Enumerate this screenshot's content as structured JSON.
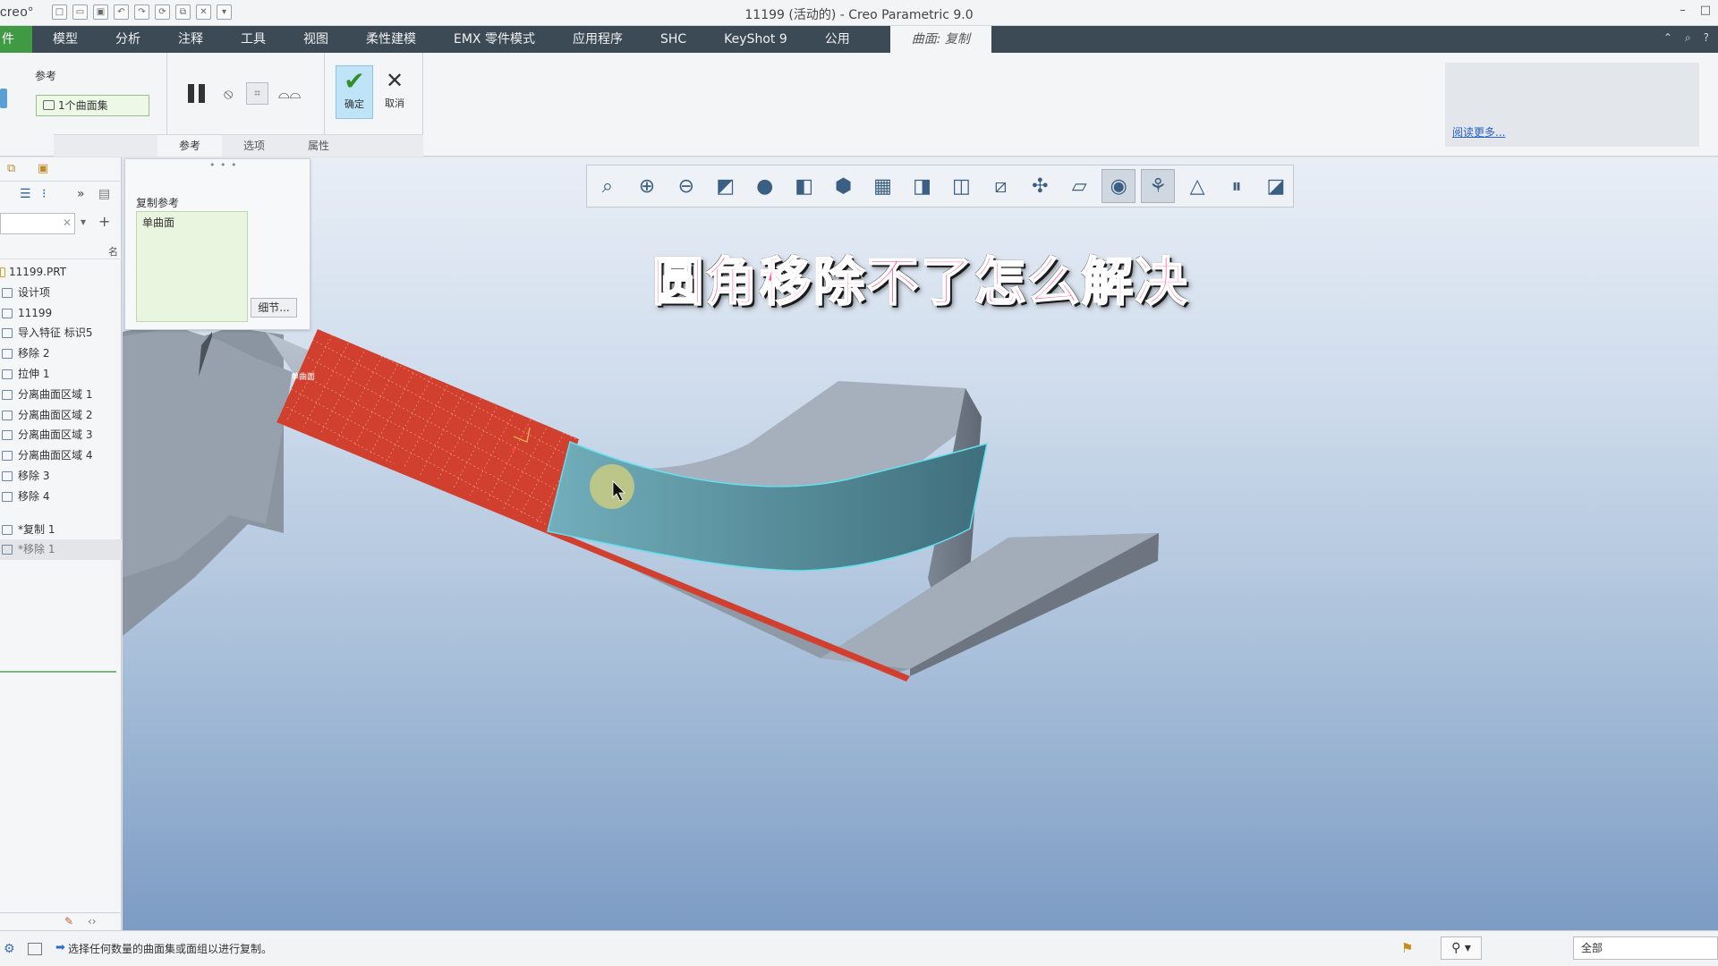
{
  "titlebar": {
    "logo": "creo°",
    "title": "11199 (活动的) - Creo Parametric 9.0",
    "quick_access_icons": [
      "new-icon",
      "open-icon",
      "save-icon",
      "undo-icon",
      "redo-icon",
      "regenerate-icon",
      "windows-icon",
      "close-icon",
      "customize-icon"
    ],
    "window_controls": [
      "–",
      "□"
    ]
  },
  "menubar": {
    "file": "件",
    "items": [
      "模型",
      "分析",
      "注释",
      "工具",
      "视图",
      "柔性建模",
      "EMX 零件模式",
      "应用程序",
      "SHC",
      "KeyShot 9",
      "公用"
    ],
    "active_tab": "曲面: 复制"
  },
  "ribbon": {
    "ref_title": "参考",
    "ref_box": "1个曲面集",
    "ok_label": "确定",
    "cancel_label": "取消",
    "sub_tabs": [
      "参考",
      "选项",
      "属性"
    ],
    "help_link": "阅读更多..."
  },
  "popup": {
    "title": "复制参考",
    "items": [
      "单曲面"
    ],
    "detail_button": "细节..."
  },
  "model_tree": {
    "header_glyph": "名",
    "items": [
      {
        "label": "11199.PRT",
        "kind": "root"
      },
      {
        "label": "设计项",
        "kind": "item"
      },
      {
        "label": "11199",
        "kind": "item"
      },
      {
        "label": "导入特征 标识5",
        "kind": "item"
      },
      {
        "label": "移除 2",
        "kind": "item"
      },
      {
        "label": "拉伸 1",
        "kind": "item"
      },
      {
        "label": "分离曲面区域 1",
        "kind": "item"
      },
      {
        "label": "分离曲面区域 2",
        "kind": "item"
      },
      {
        "label": "分离曲面区域 3",
        "kind": "item"
      },
      {
        "label": "分离曲面区域 4",
        "kind": "item"
      },
      {
        "label": "移除 3",
        "kind": "item"
      },
      {
        "label": "移除 4",
        "kind": "item"
      },
      {
        "label": "*复制 1",
        "kind": "copy"
      },
      {
        "label": "*移除 1",
        "kind": "selected"
      }
    ]
  },
  "graphics": {
    "overlay_title": "圆角移除不了怎么解决",
    "surface_tag": "单曲面",
    "toolbar_icons": [
      "refit-icon",
      "zoom-in-icon",
      "zoom-out-icon",
      "repaint-icon",
      "display-style-icon",
      "saved-orientations-icon",
      "view-manager-icon",
      "perspective-icon",
      "section-icon",
      "annotation-display-icon",
      "datum-display-icon",
      "plane-display-icon",
      "spin-center-icon",
      "appearance-icon",
      "pause-icon",
      "render-icon"
    ]
  },
  "statusbar": {
    "message": "选择任何数量的曲面集或面组以进行复制。",
    "filter": "全部"
  },
  "colors": {
    "menubar_bg": "#3c4a56",
    "file_tab": "#3f9a43",
    "overlay_text": "#ff5c92",
    "selected_surface": "#d13f2e",
    "highlight_surface": "#5e96a5"
  }
}
